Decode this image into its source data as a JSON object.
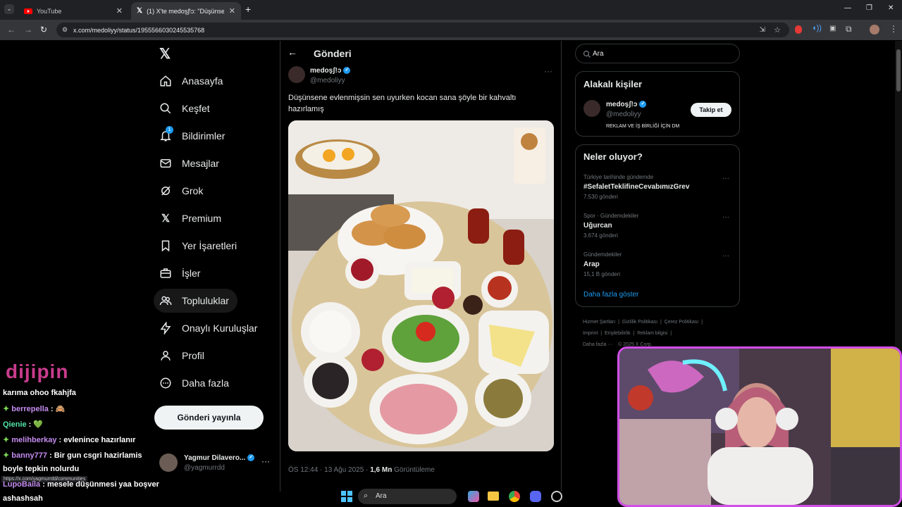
{
  "browser": {
    "tabs": [
      {
        "title": "YouTube"
      },
      {
        "title": "(1) X'te medoşʃ!ɔ: \"Düşünsene"
      }
    ],
    "url": "x.com/medoliyy/status/1955566030245535768"
  },
  "nav": {
    "items": [
      {
        "label": "Anasayfa",
        "icon": "home-icon"
      },
      {
        "label": "Keşfet",
        "icon": "search-icon"
      },
      {
        "label": "Bildirimler",
        "icon": "bell-icon",
        "badge": "1"
      },
      {
        "label": "Mesajlar",
        "icon": "mail-icon"
      },
      {
        "label": "Grok",
        "icon": "grok-icon"
      },
      {
        "label": "Premium",
        "icon": "x-logo-icon"
      },
      {
        "label": "Yer İşaretleri",
        "icon": "bookmark-icon"
      },
      {
        "label": "İşler",
        "icon": "briefcase-icon"
      },
      {
        "label": "Topluluklar",
        "icon": "people-icon"
      },
      {
        "label": "Onaylı Kuruluşlar",
        "icon": "lightning-icon"
      },
      {
        "label": "Profil",
        "icon": "person-icon"
      },
      {
        "label": "Daha fazla",
        "icon": "more-circle-icon"
      }
    ],
    "post_button": "Gönderi yayınla",
    "account": {
      "name": "Yagmur Dilavero...",
      "handle": "@yagmurrdd"
    }
  },
  "main": {
    "header": "Gönderi",
    "post": {
      "author": "medoşʃ!ɔ",
      "handle": "@medoliyy",
      "text": "Düşünsene evlenmişsin sen uyurken kocan sana şöyle bir kahvaltı hazırlamış",
      "time": "ÖS 12:44 · 13 Ağu 2025 · ",
      "views": "1,6 Mn",
      "views_label": " Görüntüleme"
    }
  },
  "right": {
    "search_placeholder": "Ara",
    "relevant": {
      "title": "Alakalı kişiler",
      "name": "medoşʃ!ɔ",
      "handle": "@medoliyy",
      "bio": "REKLAM VE İŞ BİRLİĞİ İÇİN DM",
      "follow": "Takip et"
    },
    "trends": {
      "title": "Neler oluyor?",
      "items": [
        {
          "context": "Türkiye tarihinde gündemde",
          "name": "#SefaletTeklifineCevabımızGrev",
          "count": "7.530 gönderi"
        },
        {
          "context": "Spor · Gündemdekiler",
          "name": "Uğurcan",
          "count": "3.674 gönderi"
        },
        {
          "context": "Gündemdekiler",
          "name": "Arap",
          "count": "15,1 B gönderi"
        }
      ],
      "more": "Daha fazla göster"
    },
    "footer": {
      "row1": [
        "Hizmet Şartları",
        "Gizlilik Politikası",
        "Çerez Politikası"
      ],
      "row2": [
        "Imprint",
        "Erişilebilirlik",
        "Reklam bilgisi"
      ],
      "row3": [
        "Daha fazla ···",
        "© 2025 X Corp."
      ]
    }
  },
  "overlay": {
    "brand": "dijipin",
    "chat": [
      {
        "user": "",
        "msg": "karıma ohoo fkahjfa"
      },
      {
        "user": "berrepella",
        "msg": " : 🙈"
      },
      {
        "user": "Qienie",
        "msg": " : 💚"
      },
      {
        "user": "melihberkay",
        "msg": " : evlenince hazırlanır"
      },
      {
        "user": "banny777",
        "msg": " : Bir gun csgri hazirlamis"
      },
      {
        "user": "",
        "msg": "boyle tepkin nolurdu"
      },
      {
        "user": "LupoBaila",
        "msg": " : mesele düşünmesi yaa boşver"
      },
      {
        "user": "",
        "msg": "ashashsah"
      }
    ],
    "status_url": "https://x.com/yagmurrdd/communities",
    "taskbar_search": "Ara"
  }
}
